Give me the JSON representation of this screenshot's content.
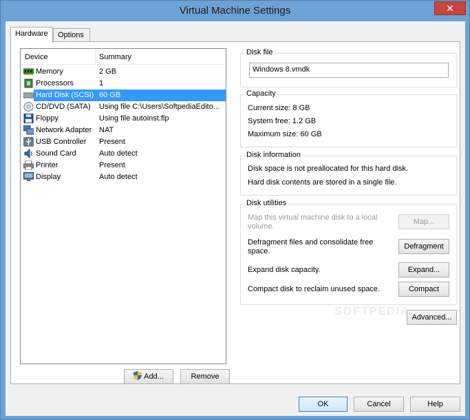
{
  "window": {
    "title": "Virtual Machine Settings",
    "close_glyph": "✕"
  },
  "tabs": [
    {
      "label": "Hardware",
      "active": true
    },
    {
      "label": "Options",
      "active": false
    }
  ],
  "device_list": {
    "columns": [
      "Device",
      "Summary"
    ],
    "rows": [
      {
        "device": "Memory",
        "summary": "2 GB",
        "icon": "memory-icon"
      },
      {
        "device": "Processors",
        "summary": "1",
        "icon": "processor-icon"
      },
      {
        "device": "Hard Disk (SCSI)",
        "summary": "60 GB",
        "icon": "hard-disk-icon",
        "selected": true
      },
      {
        "device": "CD/DVD (SATA)",
        "summary": "Using file C:\\Users\\SoftpediaEdito...",
        "icon": "cd-dvd-icon"
      },
      {
        "device": "Floppy",
        "summary": "Using file autoinst.flp",
        "icon": "floppy-icon"
      },
      {
        "device": "Network Adapter",
        "summary": "NAT",
        "icon": "network-adapter-icon"
      },
      {
        "device": "USB Controller",
        "summary": "Present",
        "icon": "usb-icon"
      },
      {
        "device": "Sound Card",
        "summary": "Auto detect",
        "icon": "sound-card-icon"
      },
      {
        "device": "Printer",
        "summary": "Present",
        "icon": "printer-icon"
      },
      {
        "device": "Display",
        "summary": "Auto detect",
        "icon": "display-icon"
      }
    ],
    "add_label": "Add...",
    "remove_label": "Remove"
  },
  "disk_file": {
    "title": "Disk file",
    "value": "Windows 8.vmdk"
  },
  "capacity": {
    "title": "Capacity",
    "current": "Current size: 8 GB",
    "system_free": "System free: 1.2 GB",
    "maximum": "Maximum size: 60 GB"
  },
  "disk_info": {
    "title": "Disk information",
    "line1": "Disk space is not preallocated for this hard disk.",
    "line2": "Hard disk contents are stored in a single file."
  },
  "disk_utilities": {
    "title": "Disk utilities",
    "map_text_1": "Map this virtual machine disk to a local",
    "map_text_2": "volume.",
    "map_label": "Map...",
    "defrag_text_1": "Defragment files and consolidate free",
    "defrag_text_2": "space.",
    "defrag_label": "Defragment",
    "expand_text": "Expand disk capacity.",
    "expand_label": "Expand...",
    "compact_text": "Compact disk to reclaim unused space.",
    "compact_label": "Compact"
  },
  "advanced_label": "Advanced...",
  "watermark": "SOFTPEDIA",
  "footer": {
    "ok_label": "OK",
    "cancel_label": "Cancel",
    "help_label": "Help"
  },
  "colors": {
    "title_bar": "#6fa2d4",
    "selection": "#3399ff",
    "close": "#c7463b"
  }
}
